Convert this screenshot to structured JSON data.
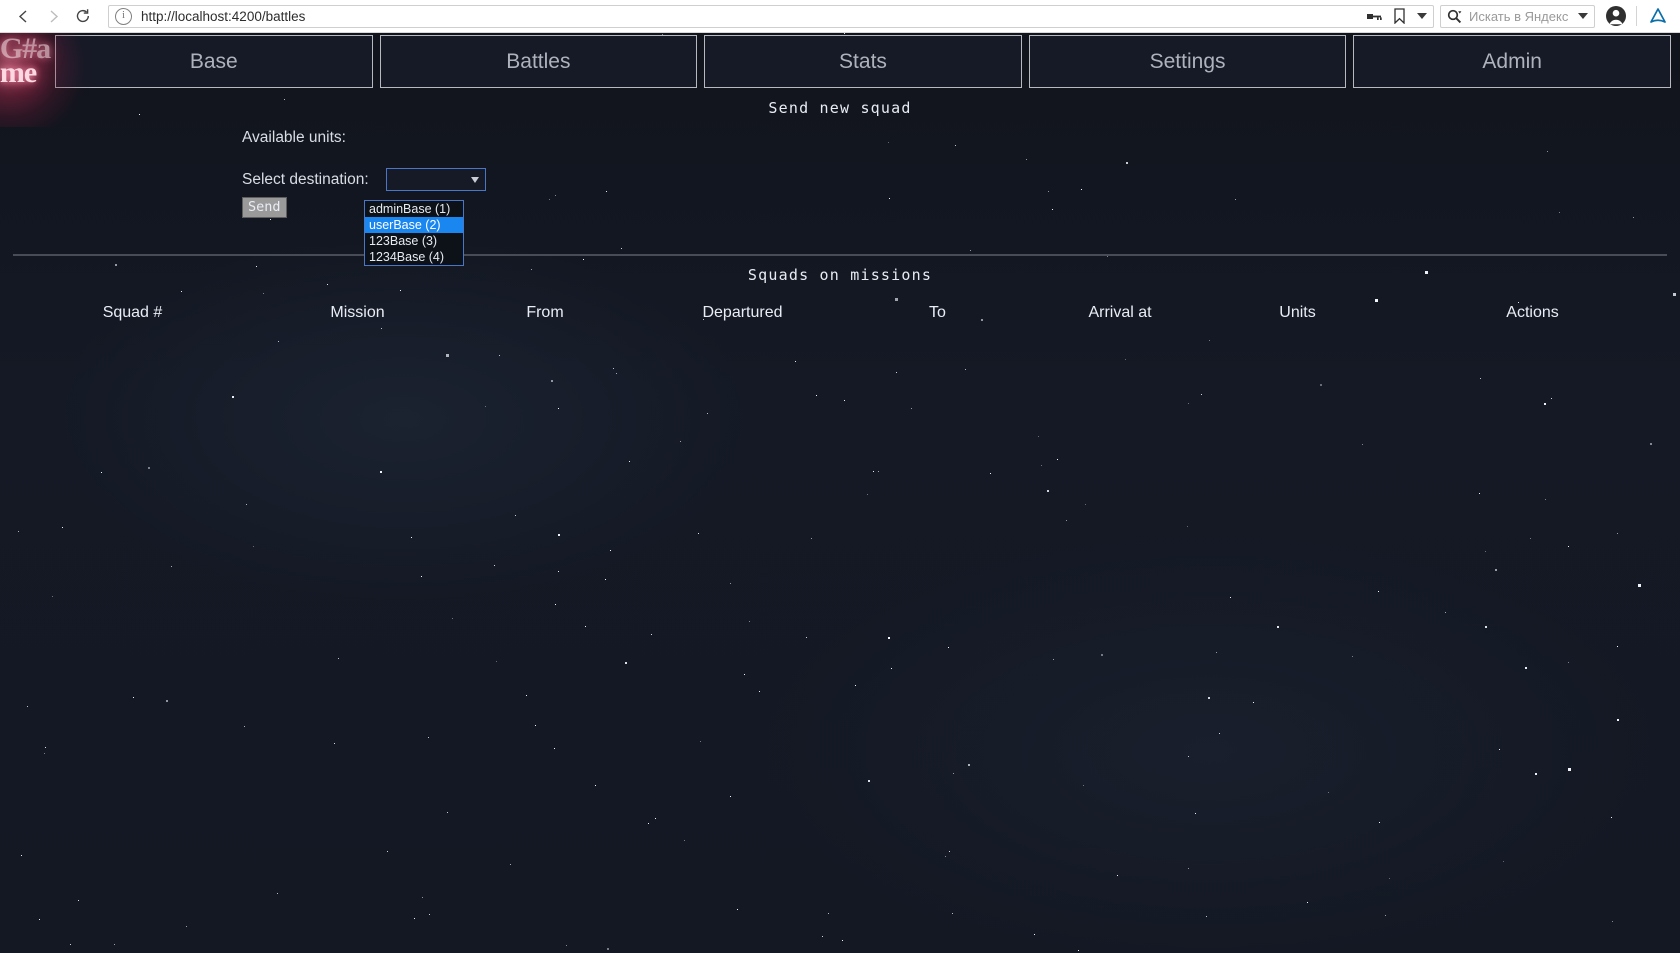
{
  "browser": {
    "back_icon": "back-arrow-icon",
    "forward_icon": "forward-arrow-icon",
    "reload_icon": "reload-icon",
    "info_icon_glyph": "i",
    "url": "http://localhost:4200/battles",
    "key_icon": "key-icon",
    "bookmark_icon": "bookmark-icon",
    "dropdown_icon": "chevron-down-icon",
    "search_icon": "search-icon",
    "search_placeholder": "Искать в Яндекс",
    "profile_icon": "profile-avatar-icon",
    "yandex_icon": "yandex-icon"
  },
  "navbar": {
    "logo_line1": "G#a",
    "logo_line2": "me",
    "tabs": [
      {
        "label": "Base"
      },
      {
        "label": "Battles"
      },
      {
        "label": "Stats"
      },
      {
        "label": "Settings"
      },
      {
        "label": "Admin"
      }
    ]
  },
  "send_squad": {
    "title": "Send new squad",
    "available_units_label": "Available units:",
    "select_destination_label": "Select destination:",
    "select_value": "",
    "options": [
      {
        "label": "adminBase (1)",
        "selected": false
      },
      {
        "label": "userBase (2)",
        "selected": true
      },
      {
        "label": "123Base (3)",
        "selected": false
      },
      {
        "label": "1234Base (4)",
        "selected": false
      }
    ],
    "send_button": "Send"
  },
  "missions": {
    "title": "Squads on missions",
    "columns": [
      "Squad #",
      "Mission",
      "From",
      "Departured",
      "To",
      "Arrival at",
      "Units",
      "Actions"
    ],
    "rows": []
  },
  "colors": {
    "page_background": "#131823",
    "tab_background": "#161a27",
    "tab_border": "#b7b9be",
    "tab_text": "#aeb2bb",
    "accent_select_border": "#4a76c8",
    "option_highlight": "#1a86f0",
    "logo_glow": "#ff6f96",
    "divider": "#474c56",
    "text_primary": "#e9edf4"
  }
}
